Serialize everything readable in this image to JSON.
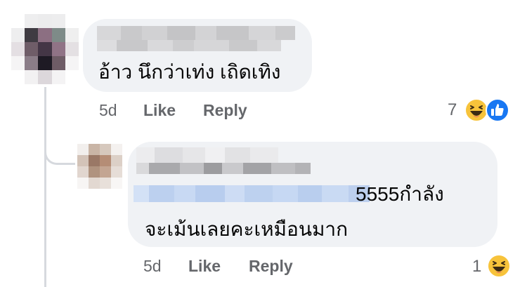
{
  "comments": [
    {
      "text": "อ้าว นึกว่าเท่ง เถิดเทิง",
      "time": "5d",
      "like_label": "Like",
      "reply_label": "Reply",
      "reaction_count": "7",
      "reactions": [
        "haha-icon",
        "like-thumb-icon"
      ]
    },
    {
      "text_line1": "5555กำลัง",
      "text_line2": "จะเม้นเลยคะเหมือนมาก",
      "time": "5d",
      "like_label": "Like",
      "reply_label": "Reply",
      "reaction_count": "1",
      "reactions": [
        "haha-icon"
      ]
    }
  ],
  "colors": {
    "bubble": "#f0f2f5",
    "text": "#050505",
    "meta": "#65676b",
    "haha_yellow": "#f7c33b",
    "like_blue": "#1877f2",
    "mention_blur": "#bcd4f5"
  }
}
